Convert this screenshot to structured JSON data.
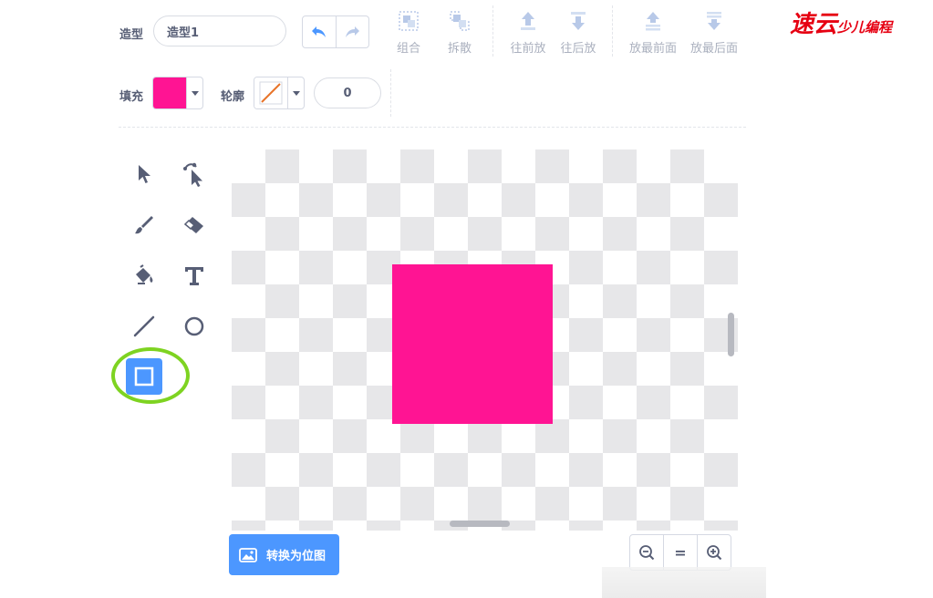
{
  "toolbar": {
    "costume_label": "造型",
    "costume_name": "造型1",
    "undo": "undo-icon",
    "redo": "redo-icon",
    "group_label": "组合",
    "ungroup_label": "拆散",
    "forward_label": "往前放",
    "backward_label": "往后放",
    "front_label": "放最前面",
    "back_label": "放最后面"
  },
  "style_row": {
    "fill_label": "填充",
    "fill_color": "#ff1493",
    "outline_label": "轮廓",
    "outline_color": "none",
    "outline_width": "0"
  },
  "tools": [
    {
      "name": "select",
      "icon": "arrow-icon"
    },
    {
      "name": "reshape",
      "icon": "reshape-icon"
    },
    {
      "name": "brush",
      "icon": "brush-icon"
    },
    {
      "name": "eraser",
      "icon": "eraser-icon"
    },
    {
      "name": "fill",
      "icon": "bucket-icon"
    },
    {
      "name": "text",
      "icon": "text-icon"
    },
    {
      "name": "line",
      "icon": "line-icon"
    },
    {
      "name": "circle",
      "icon": "circle-icon"
    },
    {
      "name": "rectangle",
      "icon": "rectangle-icon",
      "selected": true
    }
  ],
  "canvas": {
    "shape_color": "#ff1493"
  },
  "bottom": {
    "bitmap_label": "转换为位图",
    "zoom_out": "zoom-out-icon",
    "zoom_reset": "=",
    "zoom_in": "zoom-in-icon"
  },
  "watermark": {
    "logo_main": "速云",
    "logo_sub": "少儿编程"
  },
  "colors": {
    "accent": "#4c97ff",
    "highlight": "#7ed321"
  }
}
